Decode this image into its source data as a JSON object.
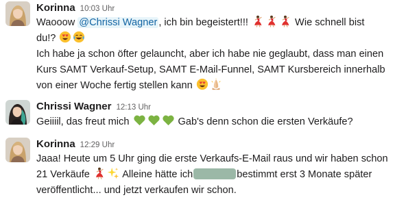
{
  "messages": [
    {
      "author": "Korinna",
      "time": "10:03 Uhr",
      "line1_pre": "Waooow ",
      "mention": "@Chrissi Wagner",
      "line1_post": ", ich bin begeistert!!! ",
      "line1_tail": " Wie schnell bist",
      "line2": "du!? ",
      "line3": "Ich habe ja schon öfter gelauncht, aber ich habe nie geglaubt, dass man einen",
      "line4": "Kurs SAMT Verkauf-Setup, SAMT E-Mail-Funnel, SAMT Kursbereich innerhalb",
      "line5": "von einer Woche fertig stellen kann ",
      "emojis": [
        "dancer-emoji",
        "dancer-emoji",
        "dancer-emoji",
        "heart-eyes-emoji",
        "laughing-tears-emoji",
        "heart-eyes-emoji",
        "folded-hands-emoji"
      ]
    },
    {
      "author": "Chrissi Wagner",
      "time": "12:13 Uhr",
      "line1_pre": "Geiiiil, das freut mich ",
      "line1_post": " Gab's denn schon die ersten Verkäufe?",
      "emojis": [
        "green-heart-emoji",
        "green-heart-emoji",
        "green-heart-emoji"
      ]
    },
    {
      "author": "Korinna",
      "time": "12:29 Uhr",
      "line1": "Jaaa! Heute um 5 Uhr ging die erste Verkaufs-E-Mail raus und wir haben schon",
      "line2_pre": "21 Verkäufe ",
      "line2_mid": " Alleine hätte ich",
      "line2_post": "bestimmt erst 3 Monate später",
      "line3": "veröffentlicht... und jetzt verkaufen wir schon.",
      "emojis": [
        "dancer-emoji",
        "sparkles-emoji"
      ]
    }
  ],
  "colors": {
    "mention_bg": "#e8f5fa",
    "mention_text": "#1264a3",
    "redaction": "#9bb8a7",
    "timestamp": "#616061"
  }
}
